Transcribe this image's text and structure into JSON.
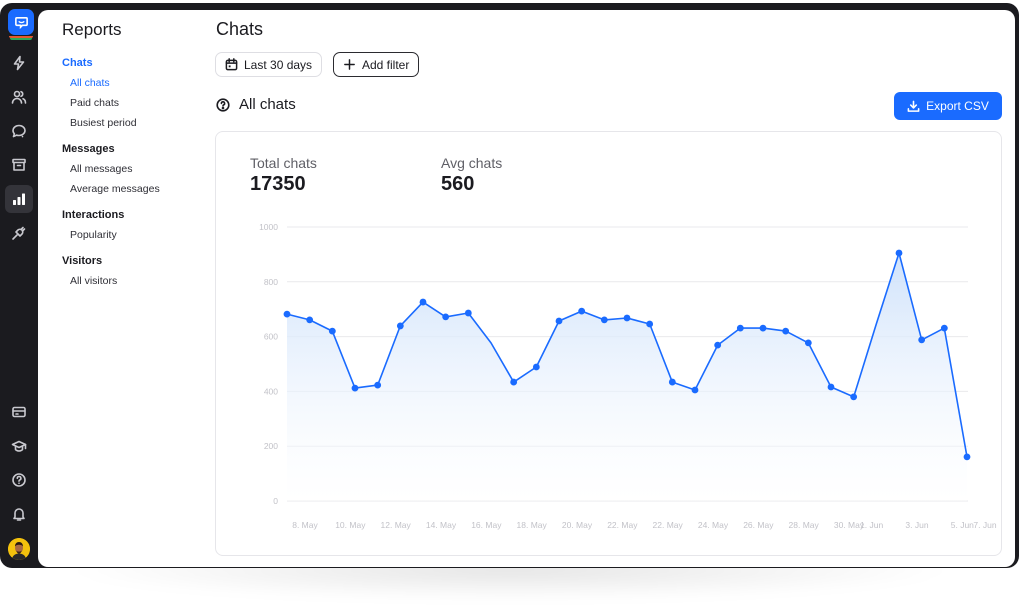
{
  "rail": {
    "logo": "chat-logo-icon",
    "top_icons": [
      {
        "name": "lightning-icon",
        "label": "Automate"
      },
      {
        "name": "users-icon",
        "label": "Customers"
      },
      {
        "name": "chat-question-icon",
        "label": "Engage"
      },
      {
        "name": "archive-icon",
        "label": "Archives"
      },
      {
        "name": "bar-chart-icon",
        "label": "Reports",
        "active": true
      },
      {
        "name": "plug-icon",
        "label": "Integrations"
      }
    ],
    "bottom_icons": [
      {
        "name": "billing-card-icon",
        "label": "Billing"
      },
      {
        "name": "graduation-cap-icon",
        "label": "Learning"
      },
      {
        "name": "help-icon",
        "label": "Help"
      },
      {
        "name": "bell-icon",
        "label": "Notifications"
      }
    ]
  },
  "nav": {
    "title": "Reports",
    "sections": [
      {
        "label": "Chats",
        "active": true,
        "items": [
          {
            "label": "All chats",
            "active": true
          },
          {
            "label": "Paid chats"
          },
          {
            "label": "Busiest period"
          }
        ]
      },
      {
        "label": "Messages",
        "items": [
          {
            "label": "All messages"
          },
          {
            "label": "Average messages"
          }
        ]
      },
      {
        "label": "Interactions",
        "items": [
          {
            "label": "Popularity"
          }
        ]
      },
      {
        "label": "Visitors",
        "items": [
          {
            "label": "All visitors"
          }
        ]
      }
    ]
  },
  "main": {
    "title": "Chats",
    "date_filter": "Last 30 days",
    "add_filter": "Add filter",
    "section_title": "All chats",
    "export_label": "Export CSV",
    "stats": [
      {
        "label": "Total chats",
        "value": "17350"
      },
      {
        "label": "Avg chats",
        "value": "560"
      }
    ]
  },
  "colors": {
    "accent": "#1a6bff",
    "rail_bg": "#1b1b1f",
    "area_top": "#cfe2fb",
    "area_bottom": "#ffffff"
  },
  "chart_data": {
    "type": "area",
    "title": "All chats",
    "xlabel": "",
    "ylabel": "",
    "ylim": [
      0,
      1000
    ],
    "yticks": [
      0,
      200,
      400,
      600,
      800,
      1000
    ],
    "grid": true,
    "x_tick_labels": [
      "8. May",
      "10. May",
      "12. May",
      "14. May",
      "16. May",
      "18. May",
      "20. May",
      "22. May",
      "22. May",
      "24. May",
      "26. May",
      "28. May",
      "30. May",
      "1. Jun",
      "3. Jun",
      "5. Jun",
      "7. Jun"
    ],
    "x_tick_indices": [
      0,
      2,
      4,
      6,
      8,
      10,
      12,
      14,
      16,
      18,
      20,
      22,
      24,
      25,
      27,
      29,
      30
    ],
    "series": [
      {
        "name": "Chats",
        "values": [
          682,
          661,
          620,
          412,
          423,
          639,
          726,
          672,
          686,
          577,
          434,
          489,
          657,
          693,
          661,
          668,
          646,
          434,
          405,
          569,
          631,
          631,
          620,
          577,
          416,
          380,
          646,
          905,
          588,
          631,
          161
        ],
        "markers_hidden_at": [
          9,
          26
        ]
      }
    ]
  }
}
